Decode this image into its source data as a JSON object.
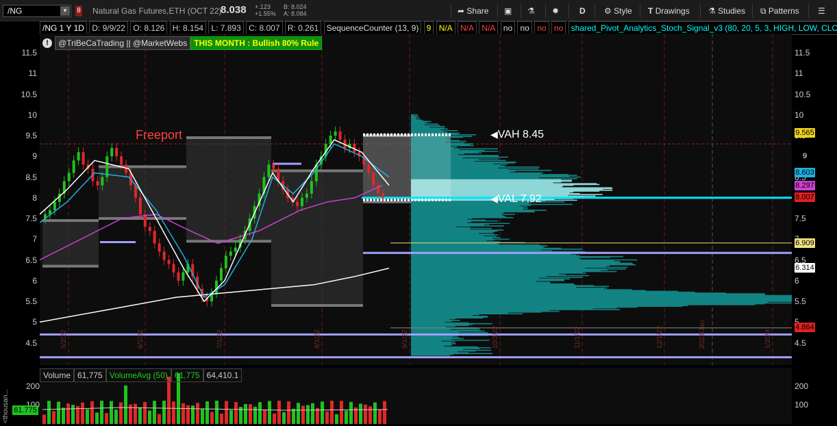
{
  "topbar": {
    "symbol": "/NG",
    "description": "Natural Gas Futures,ETH (OCT 22)",
    "last": "8.038",
    "change": "+.123",
    "change_pct": "+1.55%",
    "bid": "B: 8.024",
    "ask": "A: 8.084",
    "buttons": {
      "share": "Share",
      "style": "Style",
      "drawings": "Drawings",
      "studies": "Studies",
      "patterns": "Patterns",
      "period": "D"
    }
  },
  "infobar": {
    "title": "/NG 1 Y 1D",
    "d": "D: 9/9/22",
    "o": "O: 8.126",
    "h": "H: 8.154",
    "l": "L: 7.893",
    "c": "C: 8.007",
    "r": "R: 0.261",
    "study1": "SequenceCounter (13, 9)",
    "vals": [
      "9",
      "N/A",
      "N/A",
      "N/A",
      "no",
      "no",
      "no",
      "no"
    ],
    "study2": "shared_Pivot_Analytics_Stoch_Signal_v3 (80, 20, 5, 3, HIGH, LOW, CLOSE,..."
  },
  "watermark": {
    "handles": "@TriBeCaTrading || @MarketWebs",
    "rule": "THIS MONTH : Bullish 80% Rule"
  },
  "annotations": {
    "freeport": "Freeport",
    "vah": "VAH  8.45",
    "val": "VAL 7.92"
  },
  "price_axis": [
    "11.5",
    "11",
    "10.5",
    "10",
    "9.5",
    "9",
    "8.5",
    "8",
    "7.5",
    "7",
    "6.5",
    "6",
    "5.5",
    "5",
    "4.5"
  ],
  "price_tags": [
    {
      "text": "9.565",
      "color": "#f0d020"
    },
    {
      "text": "9",
      "color": "#000000"
    },
    {
      "text": "8.603",
      "color": "#20b0e0"
    },
    {
      "text": "8.297",
      "color": "#d040d0"
    },
    {
      "text": "8.007",
      "color": "#e02020"
    },
    {
      "text": "6.909",
      "color": "#f0e080"
    },
    {
      "text": "6.314",
      "color": "#ffffff"
    },
    {
      "text": "4.864",
      "color": "#e02020"
    }
  ],
  "date_labels": [
    "5/2/22",
    "6/1/22",
    "7/1/22",
    "8/1/22",
    "9/1/22",
    "10/3/22",
    "11/1/22",
    "12/1/22",
    "2023/Jan",
    "1/2/23"
  ],
  "volume": {
    "label": "Volume",
    "value": "61,775",
    "avg_label": "VolumeAvg (50)",
    "avg_value": "61,775",
    "avg2": "64,410.1",
    "axis": [
      "200",
      "100"
    ],
    "left_unit": "<thousan...",
    "tag": "61.775"
  },
  "colors": {
    "up": "#1fc21f",
    "down": "#e02828",
    "cyan": "#00e5ff",
    "teal": "#1a8a8a",
    "lavender": "#a0a0ff"
  }
}
